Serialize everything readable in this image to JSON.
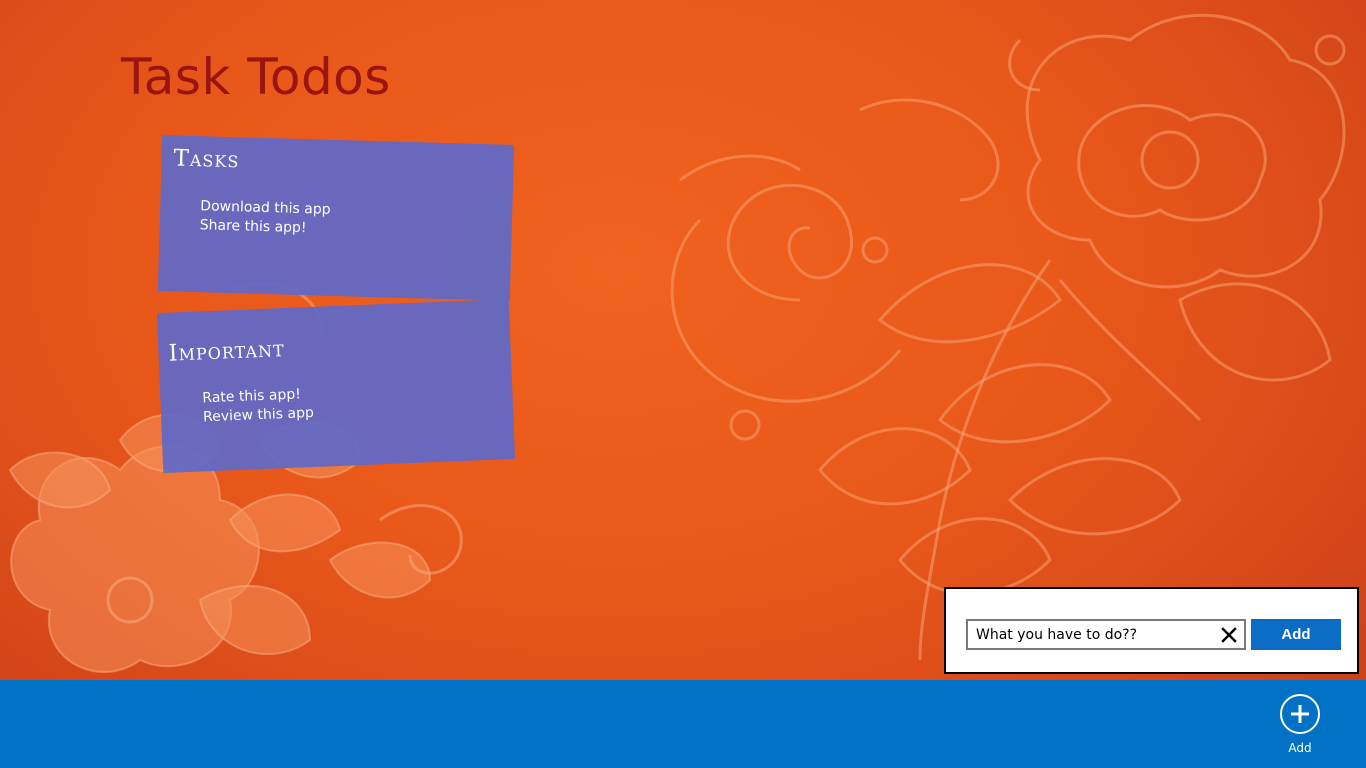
{
  "app": {
    "title": "Task Todos"
  },
  "groups": [
    {
      "title": "Tasks",
      "items": [
        "Download this app",
        "Share this app!"
      ]
    },
    {
      "title": "Important",
      "items": [
        "Rate this app!",
        "Review this app"
      ]
    }
  ],
  "add_flyout": {
    "input_value": "What you have to do??",
    "clear_icon": "close-icon",
    "add_label": "Add"
  },
  "app_bar": {
    "add_label": "Add",
    "add_icon": "add-circle-icon"
  },
  "colors": {
    "background": "#e8581a",
    "title": "#9a1410",
    "card": "#5f69c8",
    "accent": "#0071c4",
    "button": "#0a6cc5"
  }
}
